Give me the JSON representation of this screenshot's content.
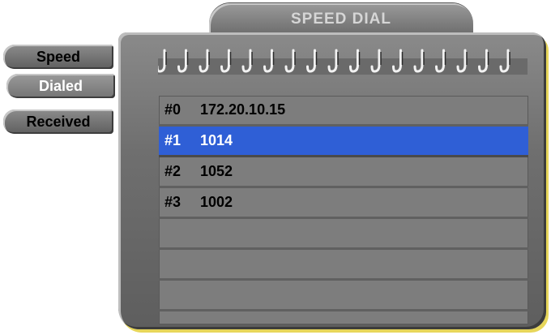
{
  "header": {
    "title": "SPEED DIAL"
  },
  "tabs": [
    {
      "label": "Speed",
      "active": false
    },
    {
      "label": "Dialed",
      "active": true
    },
    {
      "label": "Received",
      "active": false
    }
  ],
  "list": {
    "rows": [
      {
        "num": "#0",
        "value": "172.20.10.15",
        "selected": false
      },
      {
        "num": "#1",
        "value": "1014",
        "selected": true
      },
      {
        "num": "#2",
        "value": "1052",
        "selected": false
      },
      {
        "num": "#3",
        "value": "1002",
        "selected": false
      },
      {
        "num": "",
        "value": "",
        "selected": false
      },
      {
        "num": "",
        "value": "",
        "selected": false
      },
      {
        "num": "",
        "value": "",
        "selected": false
      }
    ]
  },
  "colors": {
    "selection": "#2f5fd6",
    "panel": "#6f6f6f",
    "accent_shadow": "#e7d65a"
  }
}
